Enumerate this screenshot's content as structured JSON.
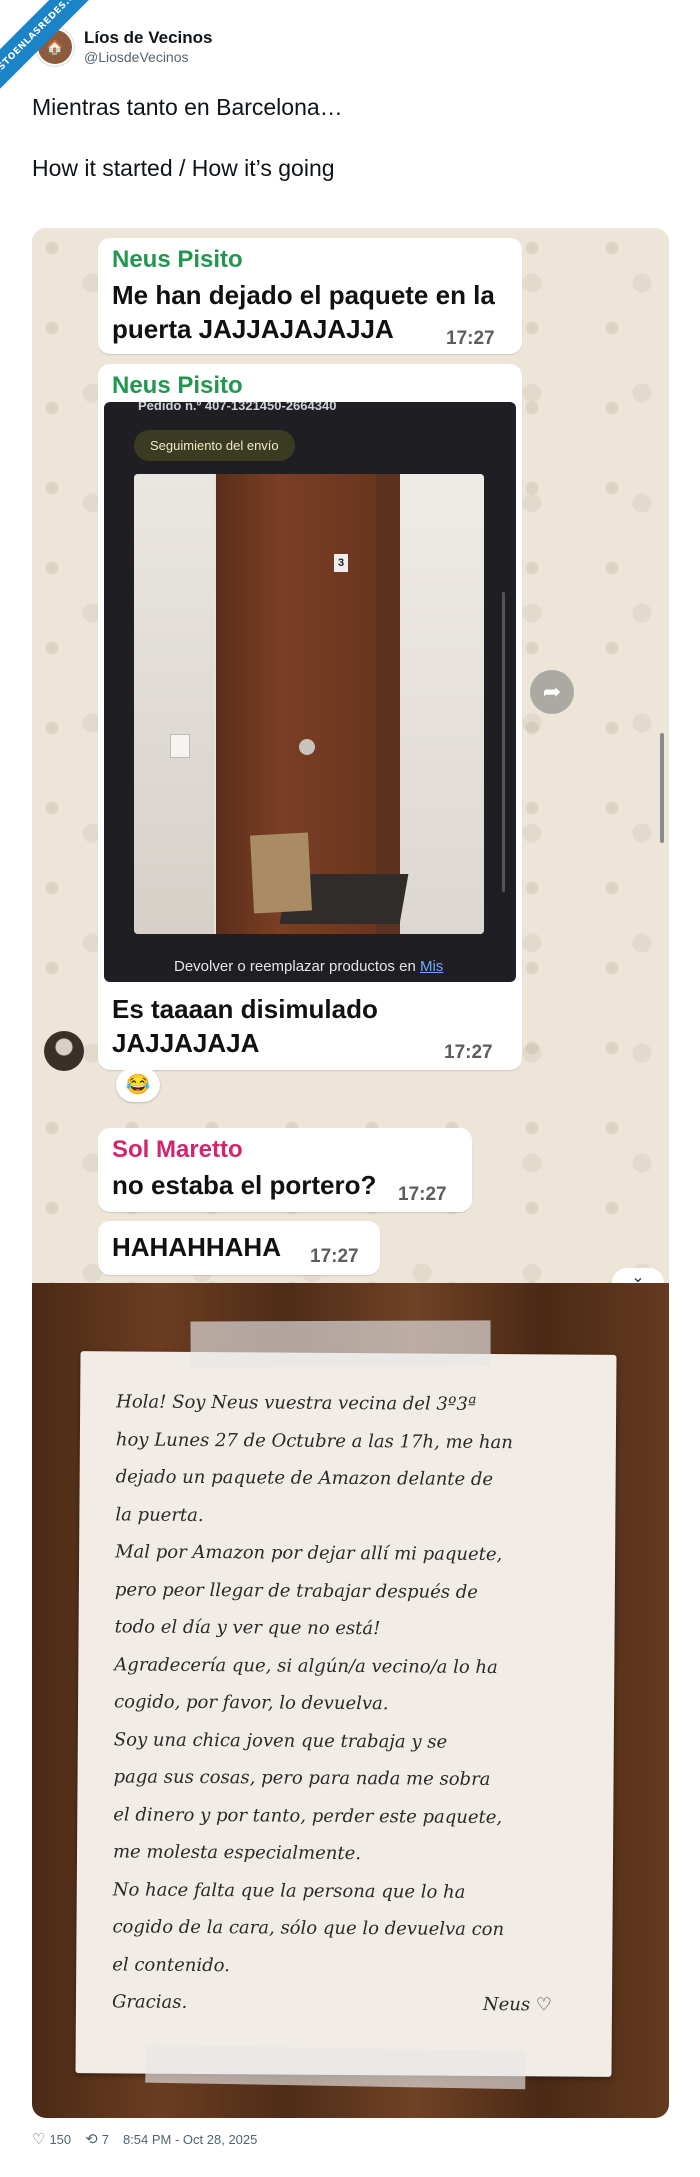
{
  "watermark": "VISTOENLASREDES.COM",
  "account": {
    "display_name": "Líos de Vecinos",
    "handle": "@LiosdeVecinos"
  },
  "tweet": {
    "line1": "Mientras tanto en Barcelona…",
    "line2": "How it started / How it’s going"
  },
  "chat": {
    "msg1": {
      "sender": "Neus Pisito",
      "text1": "Me han dejado el paquete en la",
      "text2": "puerta JAJJAJAJAJJA",
      "time": "17:27"
    },
    "msg2": {
      "sender": "Neus Pisito",
      "order_line": "Pedido n.º 407-1321450-2664340",
      "tracking_label": "Seguimiento del envío",
      "return_text": "Devolver o reemplazar productos en",
      "return_link": "Mis",
      "door_number": "3",
      "caption1": "Es taaaan disimulado",
      "caption2": "JAJJAJAJA",
      "time": "17:27",
      "reaction": "😂"
    },
    "msg3": {
      "sender": "Sol Maretto",
      "text": "no estaba el portero?",
      "time": "17:27"
    },
    "msg4": {
      "text": "HAHAHHAHA",
      "time": "17:27"
    }
  },
  "note": {
    "lines": [
      "Hola! Soy Neus vuestra vecina del 3º3ª",
      "hoy Lunes 27 de Octubre a las 17h, me han",
      "dejado un paquete de Amazon delante de",
      "la puerta.",
      "Mal por Amazon por dejar allí mi paquete,",
      "pero peor llegar de trabajar después de",
      "todo el día y ver que no está!",
      "Agradecería que, si algún/a vecino/a lo ha",
      "cogido, por favor, lo devuelva.",
      "Soy una chica joven que trabaja y se",
      "paga sus cosas, pero para nada me sobra",
      "el dinero y por tanto, perder este paquete,",
      "me molesta especialmente.",
      "No hace falta que la persona que lo ha",
      "cogido de la cara, sólo que lo devuelva con",
      "el contenido."
    ],
    "thanks": "Gracias.",
    "signature": "Neus ♡"
  },
  "footer": {
    "likes": "150",
    "retweets": "7",
    "timestamp": "8:54 PM - Oct 28, 2025"
  }
}
